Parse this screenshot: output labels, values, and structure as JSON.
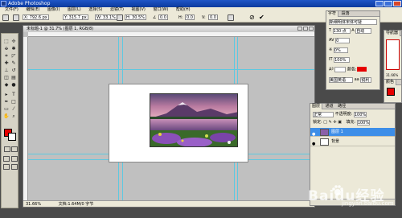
{
  "app": {
    "title": "Adobe Photoshop"
  },
  "menu": [
    "文件(F)",
    "编辑(E)",
    "图像(I)",
    "图层(L)",
    "选择(S)",
    "滤镜(T)",
    "视图(V)",
    "窗口(W)",
    "帮助(H)"
  ],
  "options": {
    "x": "X: 792.6 px",
    "y": "Y: 315.7 px",
    "w": "W: 33.1%",
    "h": "H: 30.5%",
    "angle": "0.0",
    "h_skew_label": "H:",
    "h_skew": "0.0",
    "v_skew_label": "V:",
    "v_skew": "0.0"
  },
  "document": {
    "title": "未标题-1 @ 31.7% (图层 1, RGB/8)",
    "zoom": "31.66%",
    "doc_info": "文档:1.64M/0 字节"
  },
  "char_panel": {
    "tabs": [
      "字符",
      "段落"
    ],
    "font": "新细明体宋体可疑",
    "size": "130 点",
    "leading": "自动",
    "tracking": "0%",
    "kerning": "0",
    "scale": "100%",
    "color_label": "颜色:",
    "language": "美国英语",
    "aa": "aa",
    "aa_mode": "锐利"
  },
  "navigator": {
    "tab": "导航器",
    "zoom": "31.66%"
  },
  "styles": {
    "tab": "颜色"
  },
  "layers": {
    "tabs": [
      "图层",
      "通道",
      "路径"
    ],
    "blend_mode": "正常",
    "opacity_label": "不透明度:",
    "opacity": "100%",
    "fill_label": "填充:",
    "fill": "100%",
    "lock_label": "锁定:",
    "items": [
      {
        "name": "图层 1"
      },
      {
        "name": "背景"
      }
    ]
  },
  "watermark": {
    "text": "Baidu经验",
    "sub": "jingyan.baidu.com"
  },
  "colors": {
    "foreground": "#e60000",
    "background": "#ffffff",
    "selection": "#3d8ee8",
    "guide": "#5ec8e0"
  }
}
